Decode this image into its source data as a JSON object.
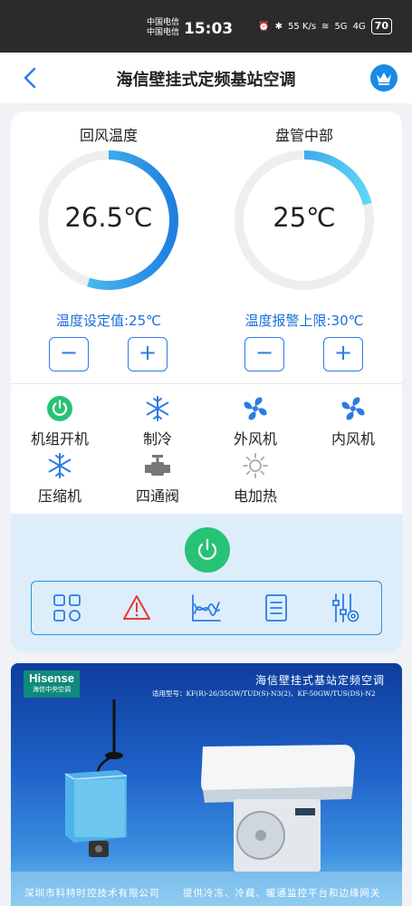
{
  "status_bar": {
    "carrier_1": "中国电信",
    "carrier_2": "中国电信",
    "time": "15:03",
    "net_speed": "55 K/s",
    "signal_1": "5G",
    "signal_2": "4G",
    "battery": "70"
  },
  "nav": {
    "title": "海信壁挂式定频基站空调"
  },
  "gauges": [
    {
      "label": "回风温度",
      "value": "26.5℃",
      "level": 0.55,
      "setting_text": "温度设定值:25℃",
      "minus": "−",
      "plus": "+"
    },
    {
      "label": "盘管中部",
      "value": "25℃",
      "level": 0.21,
      "setting_text": "温度报警上限:30℃",
      "minus": "−",
      "plus": "+"
    }
  ],
  "status_items": [
    {
      "label": "机组开机",
      "icon": "power-on-icon",
      "color": "#27c276"
    },
    {
      "label": "制冷",
      "icon": "snowflake-icon",
      "color": "#2c7be5"
    },
    {
      "label": "外风机",
      "icon": "fan-icon",
      "color": "#2c7be5"
    },
    {
      "label": "内风机",
      "icon": "fan-icon",
      "color": "#2c7be5"
    },
    {
      "label": "压缩机",
      "icon": "snowflake-icon",
      "color": "#2c7be5"
    },
    {
      "label": "四通阀",
      "icon": "valve-icon",
      "color": "#777777"
    },
    {
      "label": "电加热",
      "icon": "sun-icon",
      "color": "#aaaaaa"
    }
  ],
  "toolbar": [
    {
      "icon": "grid-icon"
    },
    {
      "icon": "alarm-warning-icon"
    },
    {
      "icon": "curve-chart-icon"
    },
    {
      "icon": "document-list-icon"
    },
    {
      "icon": "settings-sliders-icon"
    }
  ],
  "banner": {
    "brand": "Hisense",
    "brand_sub": "海信中央空调",
    "title": "海信壁挂式基站定频空调",
    "models": "适用型号：KF(R)-26/35GW/TUD(S)-N3(2)、KF-50GW/TUS(DS)-N2",
    "company": "深圳市科特时控技术有限公司",
    "slogan": "提供冷冻、冷藏、暖通监控平台和边缘网关"
  },
  "colors": {
    "accent": "#2c7be5",
    "gauge_start": "#1e7fe0",
    "gauge_end": "#5fd6f5",
    "power_green": "#27c276",
    "alarm_red": "#e53935"
  }
}
